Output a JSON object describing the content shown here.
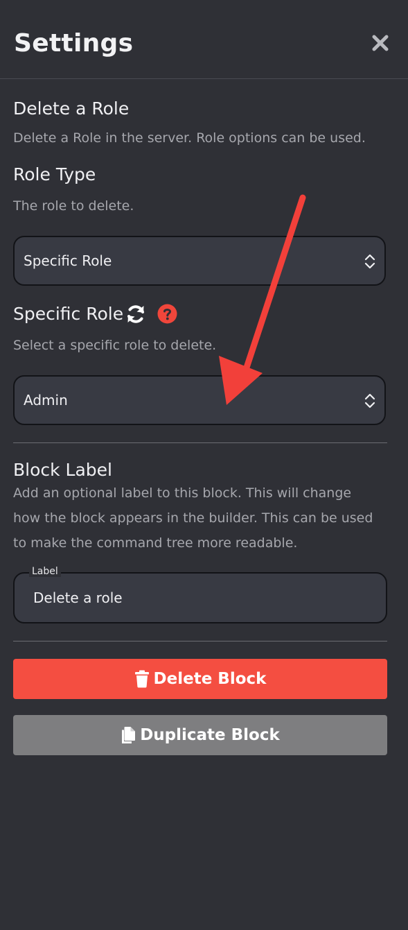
{
  "header": {
    "title": "Settings",
    "close_icon": "close-icon"
  },
  "block": {
    "title": "Delete a Role",
    "description": "Delete a Role in the server. Role options can be used."
  },
  "role_type": {
    "title": "Role Type",
    "description": "The role to delete.",
    "value": "Specific Role"
  },
  "specific_role": {
    "title": "Specific Role",
    "description": "Select a specific role to delete.",
    "value": "Admin",
    "refresh_icon": "refresh-icon",
    "help_icon": "question-circle-icon"
  },
  "block_label": {
    "title": "Block Label",
    "description_lines": [
      "Add an optional label to this block. This will change",
      "how the block appears in the builder. This can be used",
      "to make the command tree more readable."
    ],
    "field_legend": "Label",
    "field_value": "Delete a role"
  },
  "buttons": {
    "delete_label": "Delete Block",
    "duplicate_label": "Duplicate Block"
  },
  "colors": {
    "background": "#2f3036",
    "field_bg": "#383a43",
    "danger": "#f44e41",
    "secondary": "#7e7e80",
    "annotation_arrow": "#f2403a"
  }
}
